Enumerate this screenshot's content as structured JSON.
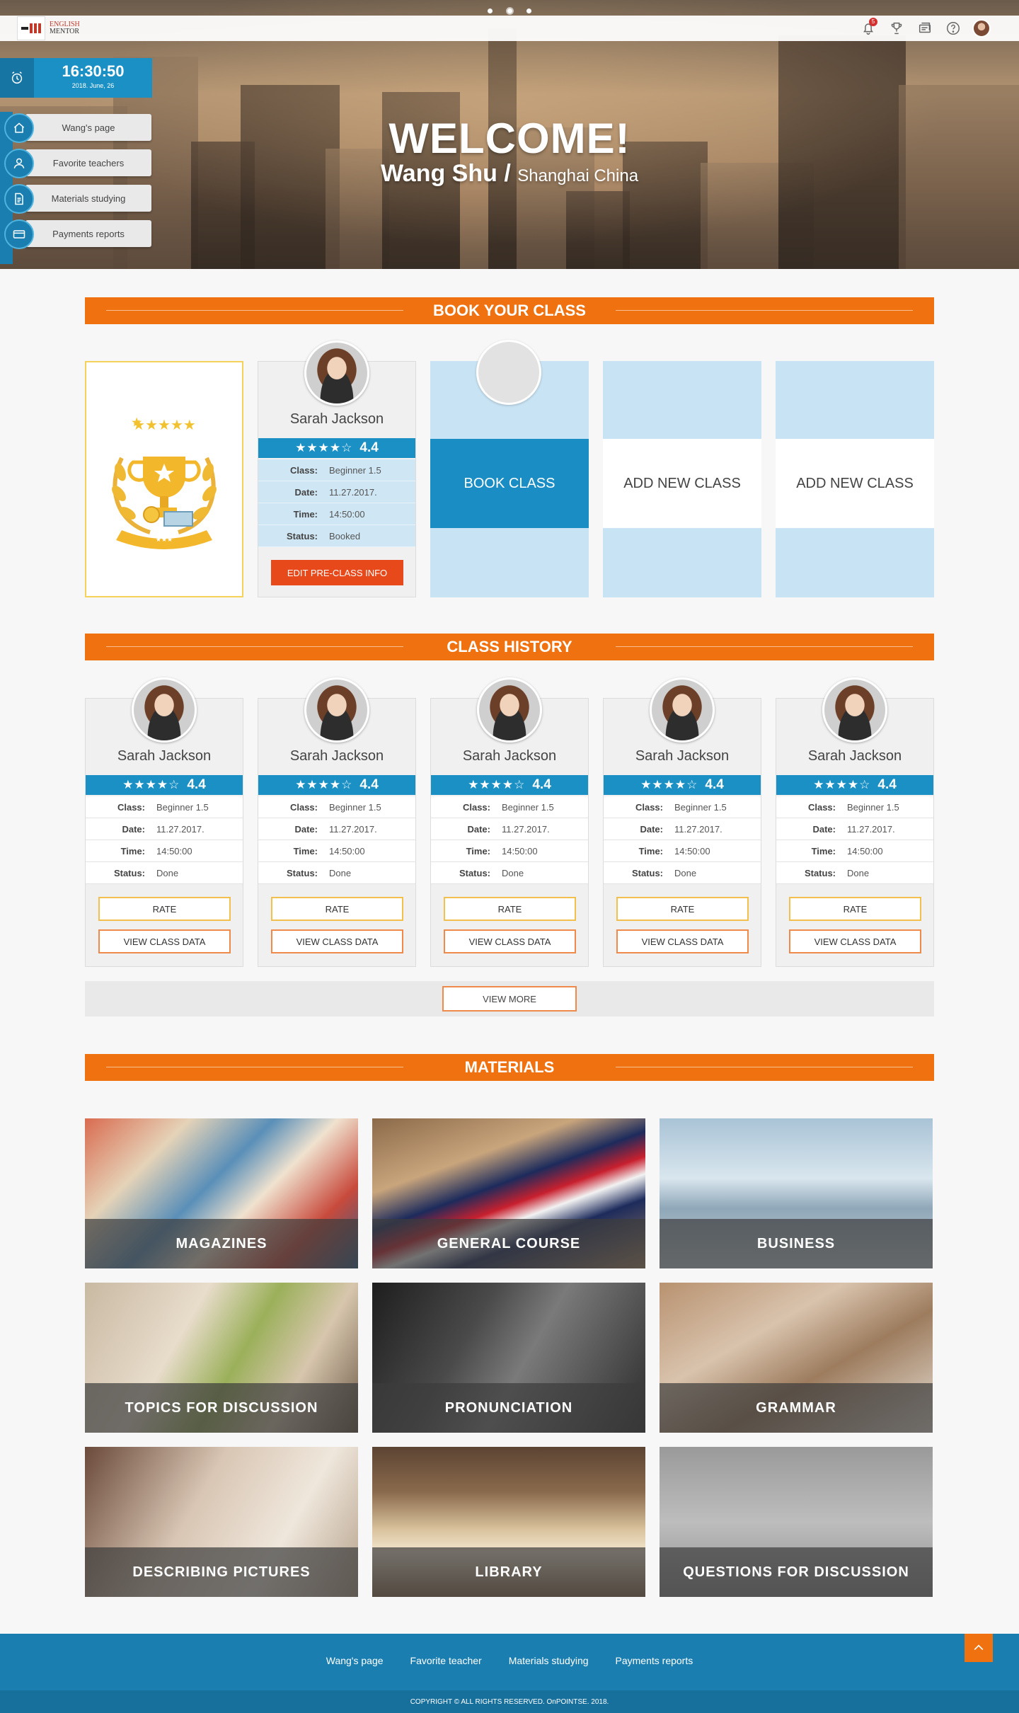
{
  "header": {
    "logo_line1": "ENGLISH",
    "logo_line2": "MENTOR",
    "notification_count": "5"
  },
  "clock": {
    "time": "16:30:50",
    "date": "2018. June, 26"
  },
  "side_nav": [
    {
      "label": "Wang's page",
      "icon": "home-icon"
    },
    {
      "label": "Favorite teachers",
      "icon": "user-icon"
    },
    {
      "label": "Materials studying",
      "icon": "document-icon"
    },
    {
      "label": "Payments reports",
      "icon": "credit-card-icon"
    }
  ],
  "welcome": {
    "title": "WELCOME!",
    "name": "Wang Shu",
    "separator": " / ",
    "location": "Shanghai China"
  },
  "book_section": {
    "title": "BOOK YOUR CLASS",
    "booked": {
      "name": "Sarah Jackson",
      "stars": "★★★★☆",
      "rating": "4.4",
      "rows": [
        {
          "k": "Class:",
          "v": "Beginner 1.5"
        },
        {
          "k": "Date:",
          "v": "11.27.2017."
        },
        {
          "k": "Time:",
          "v": "14:50:00"
        },
        {
          "k": "Status:",
          "v": "Booked"
        }
      ],
      "button": "EDIT PRE-CLASS INFO"
    },
    "book_label": "BOOK CLASS",
    "add_label_1": "ADD NEW CLASS",
    "add_label_2": "ADD NEW CLASS"
  },
  "history_section": {
    "title": "CLASS HISTORY",
    "cards": [
      {
        "name": "Sarah Jackson",
        "stars": "★★★★☆",
        "rating": "4.4",
        "class": "Beginner 1.5",
        "date": "11.27.2017.",
        "time": "14:50:00",
        "status": "Done"
      },
      {
        "name": "Sarah Jackson",
        "stars": "★★★★☆",
        "rating": "4.4",
        "class": "Beginner 1.5",
        "date": "11.27.2017.",
        "time": "14:50:00",
        "status": "Done"
      },
      {
        "name": "Sarah Jackson",
        "stars": "★★★★☆",
        "rating": "4.4",
        "class": "Beginner 1.5",
        "date": "11.27.2017.",
        "time": "14:50:00",
        "status": "Done"
      },
      {
        "name": "Sarah Jackson",
        "stars": "★★★★☆",
        "rating": "4.4",
        "class": "Beginner 1.5",
        "date": "11.27.2017.",
        "time": "14:50:00",
        "status": "Done"
      },
      {
        "name": "Sarah Jackson",
        "stars": "★★★★☆",
        "rating": "4.4",
        "class": "Beginner 1.5",
        "date": "11.27.2017.",
        "time": "14:50:00",
        "status": "Done"
      }
    ],
    "labels": {
      "class": "Class:",
      "date": "Date:",
      "time": "Time:",
      "status": "Status:"
    },
    "rate_label": "RATE",
    "view_label": "VIEW CLASS DATA",
    "view_more": "VIEW MORE"
  },
  "materials_section": {
    "title": "MATERIALS",
    "tiles": [
      "MAGAZINES",
      "GENERAL COURSE",
      "BUSINESS",
      "TOPICS FOR DISCUSSION",
      "PRONUNCIATION",
      "GRAMMAR",
      "DESCRIBING PICTURES",
      "LIBRARY",
      "QUESTIONS FOR DISCUSSION"
    ]
  },
  "footer": {
    "links": [
      "Wang's page",
      "Favorite teacher",
      "Materials studying",
      "Payments reports"
    ],
    "copyright": "COPYRIGHT © ALL RIGHTS RESERVED. OnPOINTSE. 2018."
  },
  "colors": {
    "accent_orange": "#f0710f",
    "accent_blue": "#1b90c4",
    "footer_blue": "#1a7fb0",
    "button_red": "#e8491b"
  }
}
